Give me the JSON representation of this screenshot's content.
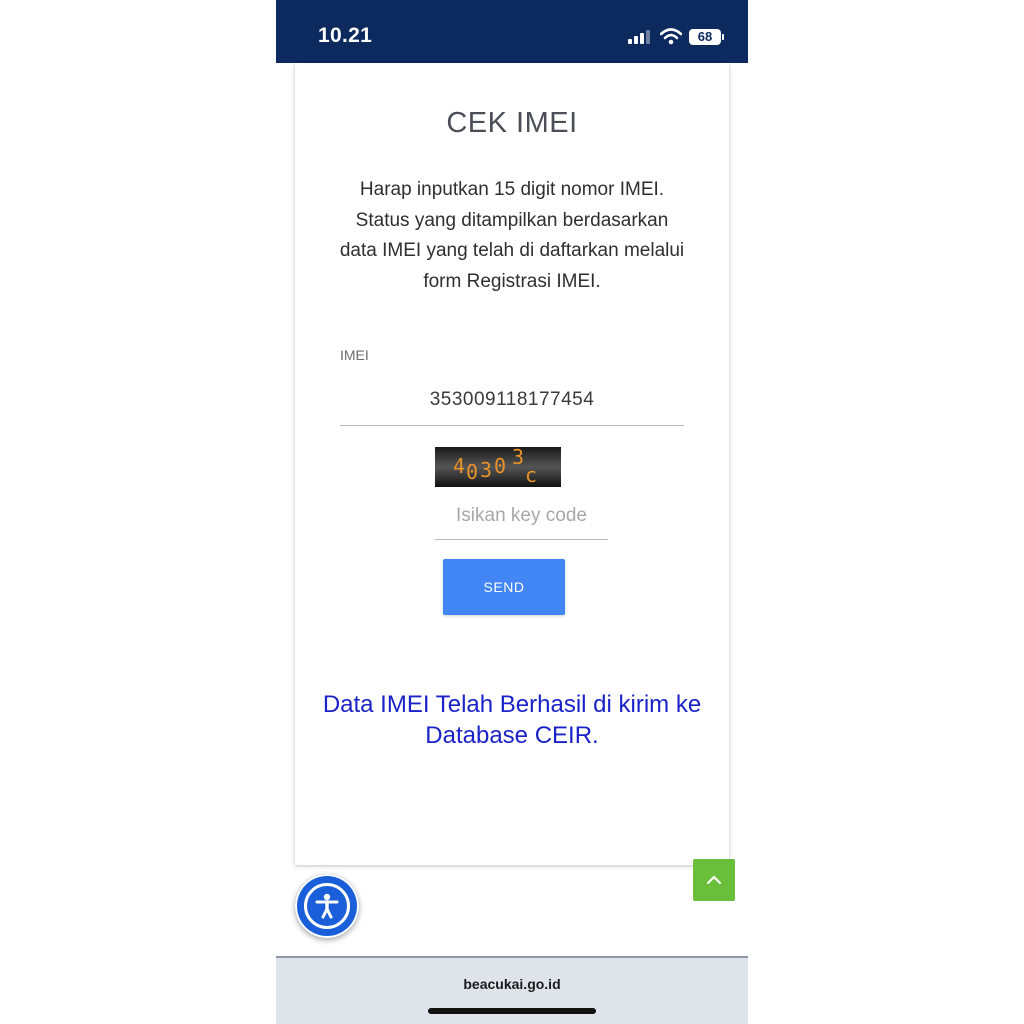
{
  "status_bar": {
    "time": "10.21",
    "battery": "68",
    "icons": [
      "signal-icon",
      "wifi-icon",
      "battery-icon"
    ]
  },
  "page": {
    "title": "CEK IMEI",
    "description": "Harap inputkan 15 digit nomor IMEI. Status yang ditampilkan berdasarkan data IMEI yang telah di daftarkan melalui form Registrasi IMEI."
  },
  "form": {
    "imei_label": "IMEI",
    "imei_value": "353009118177454",
    "captcha_text": "40303c",
    "keycode_placeholder": "Isikan key code",
    "send_label": "SEND"
  },
  "result": {
    "message": "Data IMEI Telah Berhasil di kirim ke Database CEIR."
  },
  "browser": {
    "url": "beacukai.go.id"
  },
  "colors": {
    "status_bar": "#0d2a5e",
    "send_button": "#4285f4",
    "success_text": "#1a22c8",
    "scroll_top": "#6abf3a",
    "accessibility": "#1a5fd9",
    "captcha_text": "#e8922a"
  }
}
